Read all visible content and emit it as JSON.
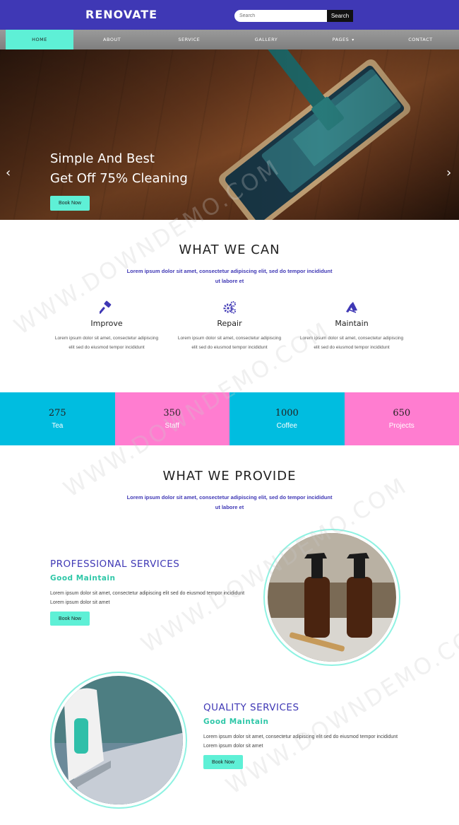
{
  "header": {
    "brand": "RENOVATE",
    "search_placeholder": "Search",
    "search_button": "Search"
  },
  "nav": {
    "items": [
      {
        "label": "HOME",
        "active": true
      },
      {
        "label": "ABOUT"
      },
      {
        "label": "SERVICE"
      },
      {
        "label": "GALLERY"
      },
      {
        "label": "PAGES",
        "has_dropdown": true
      },
      {
        "label": "CONTACT"
      }
    ]
  },
  "hero": {
    "title_line1": "Simple And Best",
    "title_line2": "Get Off 75% Cleaning",
    "button": "Book Now",
    "prev_arrow": "‹",
    "next_arrow": "›"
  },
  "what_we_can": {
    "title": "WHAT WE CAN",
    "subtitle": "Lorem ipsum dolor sit amet, consectetur adipiscing elit, sed do tempor incididunt ut labore et",
    "services": [
      {
        "icon": "hammer-icon",
        "name": "Improve",
        "text": "Lorem ipsum dolor sit amet, consectetur adipiscing elit sed do eiusmod tempor incididunt"
      },
      {
        "icon": "gears-icon",
        "name": "Repair",
        "text": "Lorem ipsum dolor sit amet, consectetur adipiscing elit sed do eiusmod tempor incididunt"
      },
      {
        "icon": "broom-icon",
        "name": "Maintain",
        "text": "Lorem ipsum dolor sit amet, consectetur adipiscing elit sed do eiusmod tempor incididunt"
      }
    ]
  },
  "stats": [
    {
      "value": "275",
      "label": "Tea"
    },
    {
      "value": "350",
      "label": "Staff"
    },
    {
      "value": "1000",
      "label": "Coffee"
    },
    {
      "value": "650",
      "label": "Projects"
    }
  ],
  "what_we_provide": {
    "title": "WHAT WE PROVIDE",
    "subtitle": "Lorem ipsum dolor sit amet, consectetur adipiscing elit, sed do tempor incididunt ut labore et",
    "blocks": [
      {
        "title": "PROFESSIONAL SERVICES",
        "subtitle": "Good Maintain",
        "text": "Lorem ipsum dolor sit amet, consectetur adipiscing elit sed do eiusmod tempor incididunt Lorem ipsum dolor sit amet",
        "button": "Book Now"
      },
      {
        "title": "QUALITY SERVICES",
        "subtitle": "Good Maintain",
        "text": "Lorem ipsum dolor sit amet, consectetur adipiscing elit sed do eiusmod tempor incididunt Lorem ipsum dolor sit amet",
        "button": "Book Now"
      }
    ]
  },
  "watermark": "WWW.DOWNDEMO.COM",
  "colors": {
    "brand_blue": "#3f38b5",
    "accent_teal": "#5ef0d6",
    "cyan": "#00bde0",
    "pink": "#ff7dd0"
  }
}
